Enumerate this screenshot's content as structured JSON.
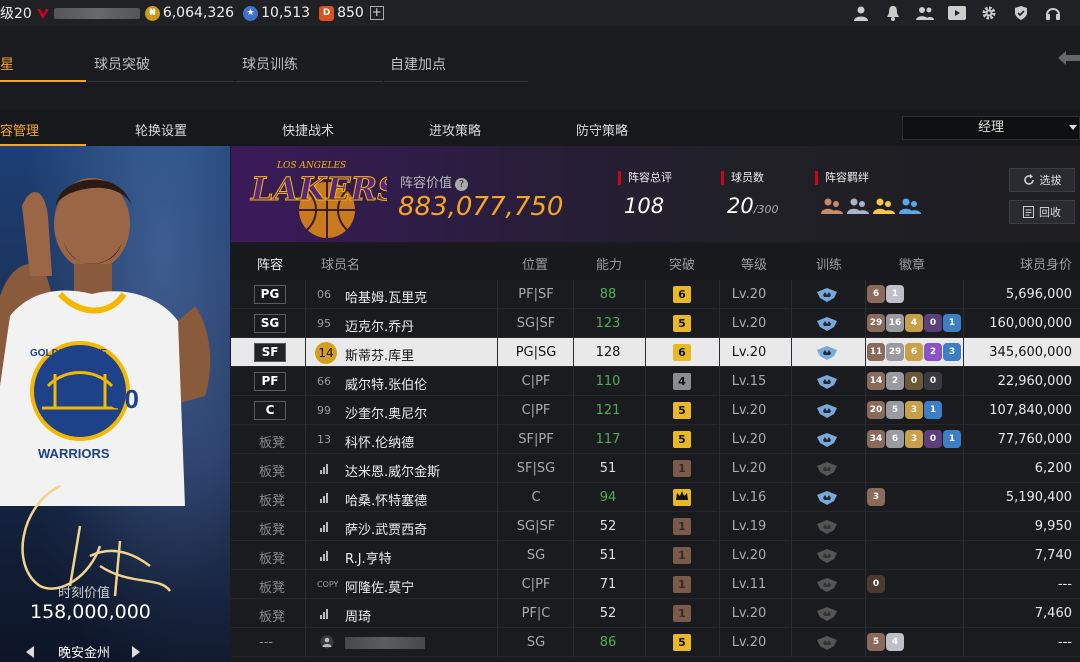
{
  "topbar": {
    "level": "级20",
    "coins": "6,064,326",
    "stars": "10,513",
    "tickets": "850",
    "plus": "+"
  },
  "tabs_primary": [
    {
      "label": "星",
      "active": true
    },
    {
      "label": "球员突破",
      "active": false
    },
    {
      "label": "球员训练",
      "active": false
    },
    {
      "label": "自建加点",
      "active": false
    }
  ],
  "tabs_secondary": [
    {
      "label": "容管理",
      "active": true
    },
    {
      "label": "轮换设置",
      "active": false
    },
    {
      "label": "快捷战术",
      "active": false
    },
    {
      "label": "进攻策略",
      "active": false
    },
    {
      "label": "防守策略",
      "active": false
    }
  ],
  "dropdown": {
    "selected": "经理"
  },
  "card": {
    "value_label": "时刻价值",
    "value": "158,000,000",
    "name": "晚安金州",
    "jersey_number": "30",
    "team_text_top": "GOLDEN STATE",
    "team_text_bottom": "WARRIORS"
  },
  "summary": {
    "logo_text": "LAKERS",
    "logo_city": "LOS ANGELES",
    "lineup_value_label": "阵容价值",
    "lineup_value": "883,077,750",
    "rating_label": "阵容总评",
    "rating": "108",
    "player_count_label": "球员数",
    "player_count": "20",
    "player_count_max": "/300",
    "bond_label": "阵容羁绊",
    "select_btn": "选拔",
    "recycle_btn": "回收"
  },
  "table": {
    "headers": {
      "lineup": "阵容",
      "name": "球员名",
      "position": "位置",
      "ability": "能力",
      "breakthrough": "突破",
      "level": "等级",
      "training": "训练",
      "badges": "徽章",
      "value": "球员身价"
    },
    "rows": [
      {
        "slot": "PG",
        "num": "06",
        "name": "哈基姆.瓦里克",
        "pos": "PF|SF",
        "ability": "88",
        "ab_green": true,
        "brk": "6",
        "brk_type": "gold",
        "level": "Lv.20",
        "train_active": true,
        "badges": [
          {
            "v": "6",
            "c": "#8a6a5a"
          },
          {
            "v": "1",
            "c": "#bfbfc8"
          }
        ],
        "value": "5,696,000"
      },
      {
        "slot": "SG",
        "num": "95",
        "name": "迈克尔.乔丹",
        "pos": "SG|SF",
        "ability": "123",
        "ab_green": true,
        "brk": "5",
        "brk_type": "gold",
        "level": "Lv.20",
        "train_active": true,
        "badges": [
          {
            "v": "29",
            "c": "#8a6a5a"
          },
          {
            "v": "16",
            "c": "#9a9aa2"
          },
          {
            "v": "4",
            "c": "#c9a04a"
          },
          {
            "v": "0",
            "c": "#5a3f7a"
          },
          {
            "v": "1",
            "c": "#3d7fc4"
          }
        ],
        "value": "160,000,000"
      },
      {
        "slot": "SF",
        "num": "14",
        "name": "斯蒂芬.库里",
        "pos": "PG|SG",
        "ability": "128",
        "ab_green": false,
        "brk": "6",
        "brk_type": "gold",
        "level": "Lv.20",
        "train_active": true,
        "badges": [
          {
            "v": "11",
            "c": "#8a6a5a"
          },
          {
            "v": "29",
            "c": "#9a9aa2"
          },
          {
            "v": "6",
            "c": "#c9a04a"
          },
          {
            "v": "2",
            "c": "#8a52c8"
          },
          {
            "v": "3",
            "c": "#3d7fc4"
          }
        ],
        "value": "345,600,000",
        "highlight": true
      },
      {
        "slot": "PF",
        "num": "66",
        "name": "威尔特.张伯伦",
        "pos": "C|PF",
        "ability": "110",
        "ab_green": true,
        "brk": "4",
        "brk_type": "silver",
        "level": "Lv.15",
        "train_active": true,
        "badges": [
          {
            "v": "14",
            "c": "#8a6a5a"
          },
          {
            "v": "2",
            "c": "#9a9aa2"
          },
          {
            "v": "0",
            "c": "#6b5a3a"
          },
          {
            "v": "0",
            "c": "#3a3a40"
          }
        ],
        "value": "22,960,000"
      },
      {
        "slot": "C",
        "num": "99",
        "name": "沙奎尔.奥尼尔",
        "pos": "C|PF",
        "ability": "121",
        "ab_green": true,
        "brk": "5",
        "brk_type": "gold",
        "level": "Lv.20",
        "train_active": true,
        "badges": [
          {
            "v": "20",
            "c": "#8a6a5a"
          },
          {
            "v": "5",
            "c": "#9a9aa2"
          },
          {
            "v": "3",
            "c": "#c9a04a"
          },
          {
            "v": "1",
            "c": "#3d7fc4"
          }
        ],
        "value": "107,840,000"
      },
      {
        "slot": "板凳",
        "num": "13",
        "name": "科怀.伦纳德",
        "pos": "SF|PF",
        "ability": "117",
        "ab_green": true,
        "brk": "5",
        "brk_type": "gold",
        "level": "Lv.20",
        "train_active": true,
        "badges": [
          {
            "v": "34",
            "c": "#8a6a5a"
          },
          {
            "v": "6",
            "c": "#9a9aa2"
          },
          {
            "v": "3",
            "c": "#c9a04a"
          },
          {
            "v": "0",
            "c": "#5a3f7a"
          },
          {
            "v": "1",
            "c": "#3d7fc4"
          }
        ],
        "value": "77,760,000"
      },
      {
        "slot": "板凳",
        "num": "",
        "signal": true,
        "name": "达米恩.威尔金斯",
        "pos": "SF|SG",
        "ability": "51",
        "ab_green": false,
        "brk": "1",
        "brk_type": "bronze",
        "level": "Lv.20",
        "train_active": false,
        "badges": [],
        "value": "6,200"
      },
      {
        "slot": "板凳",
        "num": "",
        "signal": true,
        "name": "哈桑.怀特塞德",
        "pos": "C",
        "ability": "94",
        "ab_green": true,
        "brk": "",
        "brk_type": "crown",
        "level": "Lv.16",
        "train_active": true,
        "badges": [
          {
            "v": "3",
            "c": "#8a6a5a"
          }
        ],
        "value": "5,190,400"
      },
      {
        "slot": "板凳",
        "num": "",
        "signal": true,
        "name": "萨沙.武贾西奇",
        "pos": "SG|SF",
        "ability": "52",
        "ab_green": false,
        "brk": "1",
        "brk_type": "bronze",
        "level": "Lv.19",
        "train_active": false,
        "badges": [],
        "value": "9,950"
      },
      {
        "slot": "板凳",
        "num": "",
        "signal": true,
        "name": "R.J.亨特",
        "pos": "SG",
        "ability": "51",
        "ab_green": false,
        "brk": "1",
        "brk_type": "bronze",
        "level": "Lv.20",
        "train_active": false,
        "badges": [],
        "value": "7,740"
      },
      {
        "slot": "板凳",
        "num": "COPY",
        "name": "阿隆佐.莫宁",
        "pos": "C|PF",
        "ability": "71",
        "ab_green": false,
        "brk": "1",
        "brk_type": "bronze",
        "level": "Lv.11",
        "train_active": false,
        "badges": [
          {
            "v": "0",
            "c": "#4a3a30"
          }
        ],
        "value": "---"
      },
      {
        "slot": "板凳",
        "num": "",
        "signal": true,
        "name": "周琦",
        "pos": "PF|C",
        "ability": "52",
        "ab_green": false,
        "brk": "1",
        "brk_type": "bronze",
        "level": "Lv.20",
        "train_active": false,
        "badges": [],
        "value": "7,460"
      },
      {
        "slot": "---",
        "num": "",
        "avatar": true,
        "name": "",
        "blur": true,
        "pos": "SG",
        "ability": "86",
        "ab_green": true,
        "brk": "5",
        "brk_type": "gold",
        "level": "Lv.20",
        "train_active": false,
        "badges": [
          {
            "v": "5",
            "c": "#8a6a5a"
          },
          {
            "v": "4",
            "c": "#bfbfc8"
          }
        ],
        "value": "---"
      }
    ]
  },
  "colors": {
    "accent": "#f5a623",
    "green": "#4caf50",
    "red": "#d0021b"
  }
}
